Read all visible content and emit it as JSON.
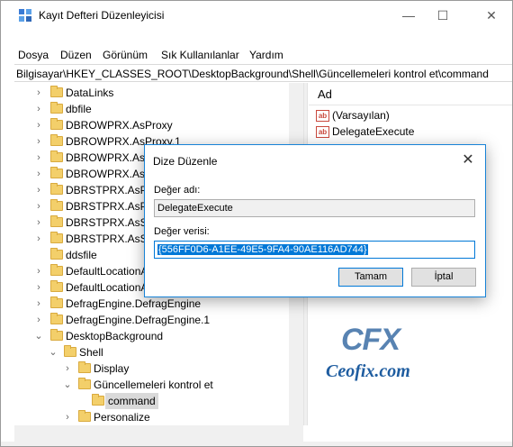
{
  "window": {
    "title": "Kayıt Defteri Düzenleyicisi",
    "minimize_glyph": "—",
    "maximize_glyph": "☐",
    "close_glyph": "✕"
  },
  "menu": [
    "Dosya",
    "Düzen",
    "Görünüm",
    "Sık Kullanılanlar",
    "Yardım"
  ],
  "address": "Bilgisayar\\HKEY_CLASSES_ROOT\\DesktopBackground\\Shell\\Güncellemeleri kontrol et\\command",
  "tree": [
    {
      "label": "DataLinks",
      "level": 0,
      "chevron": "›"
    },
    {
      "label": "dbfile",
      "level": 0,
      "chevron": "›"
    },
    {
      "label": "DBROWPRX.AsProxy",
      "level": 0,
      "chevron": "›"
    },
    {
      "label": "DBROWPRX.AsProxy.1",
      "level": 0,
      "chevron": "›"
    },
    {
      "label": "DBROWPRX.AsServer",
      "level": 0,
      "chevron": "›"
    },
    {
      "label": "DBROWPRX.AsServer.1",
      "level": 0,
      "chevron": "›"
    },
    {
      "label": "DBRSTPRX.AsProxy",
      "level": 0,
      "chevron": "›"
    },
    {
      "label": "DBRSTPRX.AsProxy.1",
      "level": 0,
      "chevron": "›"
    },
    {
      "label": "DBRSTPRX.AsServer",
      "level": 0,
      "chevron": "›"
    },
    {
      "label": "DBRSTPRX.AsServer.1",
      "level": 0,
      "chevron": "›"
    },
    {
      "label": "ddsfile",
      "level": 0,
      "chevron": ""
    },
    {
      "label": "DefaultLocationApi",
      "level": 0,
      "chevron": "›"
    },
    {
      "label": "DefaultLocationApi.1",
      "level": 0,
      "chevron": "›"
    },
    {
      "label": "DefragEngine.DefragEngine",
      "level": 0,
      "chevron": "›"
    },
    {
      "label": "DefragEngine.DefragEngine.1",
      "level": 0,
      "chevron": "›"
    },
    {
      "label": "DesktopBackground",
      "level": 0,
      "chevron": "⌄"
    },
    {
      "label": "Shell",
      "level": 1,
      "chevron": "⌄"
    },
    {
      "label": "Display",
      "level": 2,
      "chevron": "›"
    },
    {
      "label": "Güncellemeleri kontrol et",
      "level": 2,
      "chevron": "⌄"
    },
    {
      "label": "command",
      "level": 3,
      "chevron": "",
      "selected": true
    },
    {
      "label": "Personalize",
      "level": 2,
      "chevron": "›"
    }
  ],
  "values_pane": {
    "header": "Ad",
    "icon": "string-value-icon",
    "icon_text": "ab",
    "rows": [
      "(Varsayılan)",
      "DelegateExecute"
    ]
  },
  "watermark": {
    "logo": "CFX",
    "text": "Ceofix.com"
  },
  "dialog": {
    "title": "Dize Düzenle",
    "close_glyph": "✕",
    "name_label": "Değer adı:",
    "name_value": "DelegateExecute",
    "data_label": "Değer verisi:",
    "data_value": "{556FF0D6-A1EE-49E5-9FA4-90AE116AD744}",
    "ok_label": "Tamam",
    "cancel_label": "İptal"
  },
  "colors": {
    "accent": "#0078d7",
    "folder": "#f3cf6a",
    "watermark": "#1f5da0"
  }
}
